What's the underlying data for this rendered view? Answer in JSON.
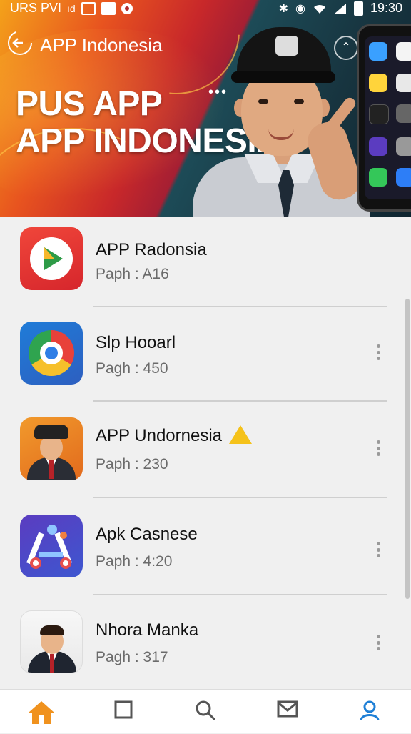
{
  "status_bar": {
    "left_text": "URS PVI",
    "time": "19:30"
  },
  "header": {
    "back_label": "APP Indonesia",
    "headline_line1": "PUS APP",
    "headline_line2": "APP INDONESIA"
  },
  "apps": [
    {
      "name": "APP Radonsia",
      "subtitle": "Paph : A16",
      "icon": "play-store-icon"
    },
    {
      "name": "Slp Hooarl",
      "subtitle": "Pagh : 450",
      "icon": "chrome-icon"
    },
    {
      "name": "APP Undornesia",
      "subtitle": "Paph : 230",
      "icon": "agent-avatar-icon",
      "badge": "warning-icon"
    },
    {
      "name": "Apk Casnese",
      "subtitle": "Paph : 4:20",
      "icon": "compass-ab-icon"
    },
    {
      "name": "Nhora Manka",
      "subtitle": "Pagh : 317",
      "icon": "man-avatar-icon"
    }
  ],
  "nav": [
    {
      "icon": "home-icon",
      "label": ""
    },
    {
      "icon": "square-icon",
      "label": ""
    },
    {
      "icon": "search-icon",
      "label": ""
    },
    {
      "icon": "mail-icon",
      "label": ""
    },
    {
      "icon": "profile-icon",
      "label": "",
      "active": true
    }
  ],
  "colors": {
    "accent": "#1e7fd6",
    "home_active": "#f0921e"
  }
}
